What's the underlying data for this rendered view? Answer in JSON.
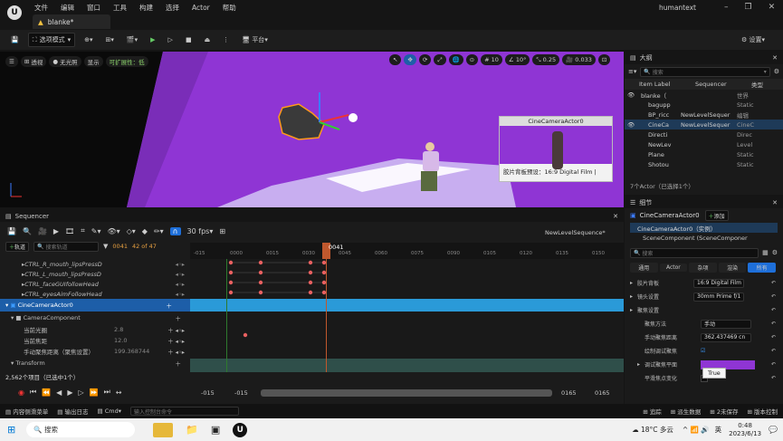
{
  "app": {
    "logo": "U",
    "tab_title": "blanke*",
    "window_title": "humantext"
  },
  "menu": [
    "文件",
    "编辑",
    "窗口",
    "工具",
    "构建",
    "选择",
    "Actor",
    "帮助"
  ],
  "toolbar": {
    "mode": "选项模式",
    "platform": "平台",
    "settings": "设置"
  },
  "viewport": {
    "view": "透视",
    "lighting": "无光照",
    "show": "显示",
    "scalability": "可扩展性：低",
    "grid": "10",
    "rotation": "10°",
    "scale": "0.25",
    "speed": "0.033",
    "preview_title": "CineCameraActor0",
    "preview_caption": "胶片背板预设：16:9 Digital Film |"
  },
  "outliner": {
    "title": "大纲",
    "search_placeholder": "搜索",
    "col_label": "Item Label",
    "col_seq": "Sequencer",
    "col_type": "类型",
    "rows": [
      {
        "label": "blanke（",
        "seq": "",
        "type": "世界"
      },
      {
        "label": "bagupp",
        "seq": "",
        "type": "Static"
      },
      {
        "label": "BP_ricc",
        "seq": "NewLevelSequer",
        "type": "编辑"
      },
      {
        "label": "CineCa",
        "seq": "NewLevelSequer",
        "type": "CineC"
      },
      {
        "label": "Directi",
        "seq": "",
        "type": "Direc"
      },
      {
        "label": "NewLev",
        "seq": "",
        "type": "Level"
      },
      {
        "label": "Plane",
        "seq": "",
        "type": "Static"
      },
      {
        "label": "Shotou",
        "seq": "",
        "type": "Static"
      }
    ],
    "footer": "7个Actor（已选择1个）"
  },
  "details": {
    "title": "细节",
    "actor": "CineCameraActor0",
    "add": "添加",
    "instance": "CineCameraActor0（实例）",
    "component": "SceneComponent (SceneComponer",
    "search_placeholder": "搜索",
    "filters": [
      "通用",
      "Actor",
      "杂项",
      "渲染",
      "所有"
    ],
    "props": [
      {
        "label": "胶片背板",
        "value": "16:9 Digital Film"
      },
      {
        "label": "镜头设置",
        "value": "30mm Prime f/1"
      },
      {
        "label": "聚焦设置",
        "value": ""
      },
      {
        "label": "聚焦方法",
        "value": "手动"
      },
      {
        "label": "手动聚焦距离",
        "value": "362.437469 cn"
      },
      {
        "label": "绘制调试聚焦",
        "value": ""
      },
      {
        "label": "调试聚焦平面",
        "value": ""
      },
      {
        "label": "平滑焦点变化",
        "value": ""
      }
    ],
    "tooltip": "True"
  },
  "sequencer": {
    "tab": "Sequencer",
    "sequence_name": "NewLevelSequence*",
    "add_track": "轨道",
    "search_placeholder": "搜索轨道",
    "frame": "0041",
    "count": "42 of 47",
    "fps": "30 fps",
    "playhead": "0041",
    "ticks": [
      "-015",
      "0000",
      "0015",
      "0030",
      "0045",
      "0060",
      "0075",
      "0090",
      "0105",
      "0120",
      "0135",
      "0150"
    ],
    "tracks": [
      {
        "label": "CTRL_R_mouth_lipsPressD",
        "value": ""
      },
      {
        "label": "CTRL_L_mouth_lipsPressD",
        "value": ""
      },
      {
        "label": "CTRL_faceGUIfollowHead",
        "value": ""
      },
      {
        "label": "CTRL_eyesAimFollowHead",
        "value": ""
      }
    ],
    "camera_track": "CineCameraActor0",
    "component": "CameraComponent",
    "props": [
      {
        "label": "当前光圈",
        "value": "2.8"
      },
      {
        "label": "当前焦距",
        "value": "12.0"
      },
      {
        "label": "手动聚焦距离（聚焦设置）",
        "value": "199.368744"
      }
    ],
    "transform": "Transform",
    "items_status": "2,562个项目（已选中1个）",
    "range_start": "-015",
    "range_start2": "-015",
    "range_end": "0165",
    "range_end2": "0165"
  },
  "statusbar": {
    "content": "内容侧滑菜单",
    "output": "输出日志",
    "cmd": "Cmd",
    "cmd_placeholder": "输入控制台命令",
    "trace": "追踪",
    "derived": "派生数据",
    "save": "2未保存",
    "vcs": "版本控制"
  },
  "taskbar": {
    "search": "搜索",
    "weather": "18°C 多云",
    "lang": "英",
    "time": "0:48",
    "date": "2023/6/13"
  },
  "colors": {
    "purple": "#8f35d4",
    "accent": "#1e90ff",
    "keyframe": "#e86060",
    "playhead": "#c0582d"
  }
}
